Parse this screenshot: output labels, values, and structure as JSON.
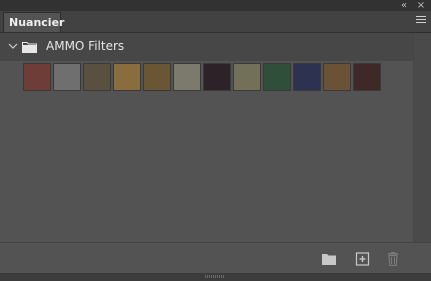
{
  "panel": {
    "tab_label": "Nuancier",
    "collapse_glyph": "«",
    "close_glyph": "×"
  },
  "group": {
    "name": "AMMO Filters",
    "expanded": true
  },
  "swatches": [
    {
      "color": "#6e3d38"
    },
    {
      "color": "#6f6f6f"
    },
    {
      "color": "#5a5040"
    },
    {
      "color": "#8a6d3f"
    },
    {
      "color": "#6a5534"
    },
    {
      "color": "#7c7a6c"
    },
    {
      "color": "#2c2228"
    },
    {
      "color": "#737059"
    },
    {
      "color": "#2f4f3b"
    },
    {
      "color": "#2d3250"
    },
    {
      "color": "#6b5236"
    },
    {
      "color": "#3f2828"
    }
  ],
  "bottom_icons": [
    "new-group-icon",
    "new-swatch-icon",
    "delete-icon"
  ]
}
